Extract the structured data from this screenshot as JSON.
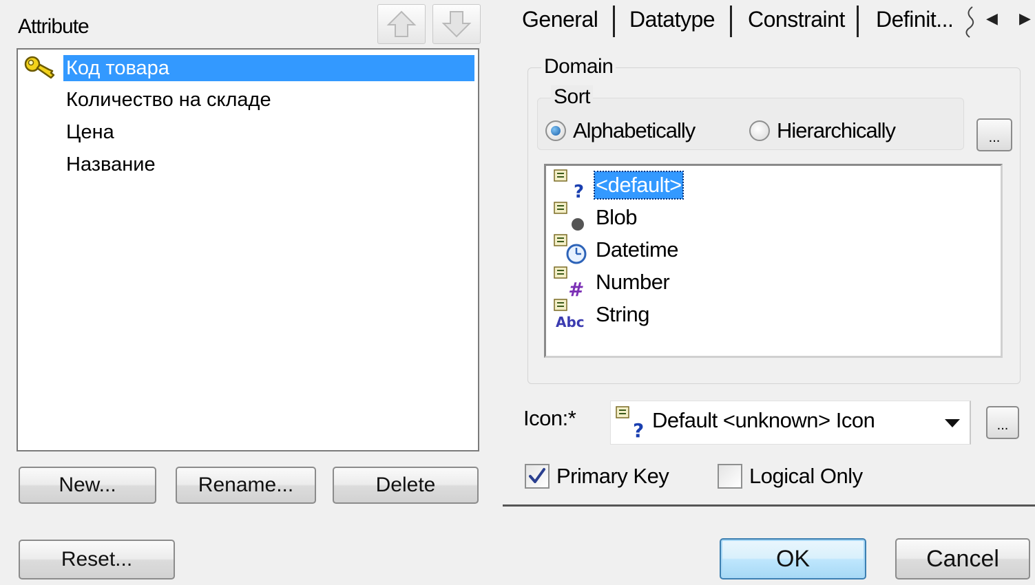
{
  "attribute_pane": {
    "label": "Attribute",
    "items": [
      {
        "label": "Код товара",
        "selected": true,
        "primary_key": true
      },
      {
        "label": "Количество на складе",
        "selected": false
      },
      {
        "label": "Цена",
        "selected": false
      },
      {
        "label": "Название",
        "selected": false
      }
    ],
    "buttons": {
      "new": "New...",
      "rename": "Rename...",
      "delete": "Delete",
      "reset": "Reset..."
    }
  },
  "tabs": [
    {
      "label": "General"
    },
    {
      "label": "Datatype"
    },
    {
      "label": "Constraint"
    },
    {
      "label": "Definit..."
    }
  ],
  "domain": {
    "label": "Domain",
    "sort": {
      "label": "Sort",
      "options": [
        "Alphabetically",
        "Hierarchically"
      ],
      "selected": "Alphabetically"
    },
    "browse_label": "...",
    "types": [
      {
        "label": "<default>",
        "icon": "question-mark-icon",
        "selected": true
      },
      {
        "label": "Blob",
        "icon": "dot-icon",
        "selected": false
      },
      {
        "label": "Datetime",
        "icon": "clock-icon",
        "selected": false
      },
      {
        "label": "Number",
        "icon": "hash-icon",
        "selected": false
      },
      {
        "label": "String",
        "icon": "abc-icon",
        "selected": false
      }
    ]
  },
  "icon_field": {
    "label": "Icon:*",
    "value": "Default <unknown> Icon",
    "browse_label": "..."
  },
  "checkboxes": {
    "primary_key": {
      "label": "Primary Key",
      "checked": true
    },
    "logical_only": {
      "label": "Logical Only",
      "checked": false
    }
  },
  "dialog_buttons": {
    "ok": "OK",
    "cancel": "Cancel"
  },
  "colors": {
    "selection": "#3399ff",
    "background": "#f0f0f0",
    "question_icon": "#1a3fb0",
    "hash_icon": "#7b2fb5"
  }
}
